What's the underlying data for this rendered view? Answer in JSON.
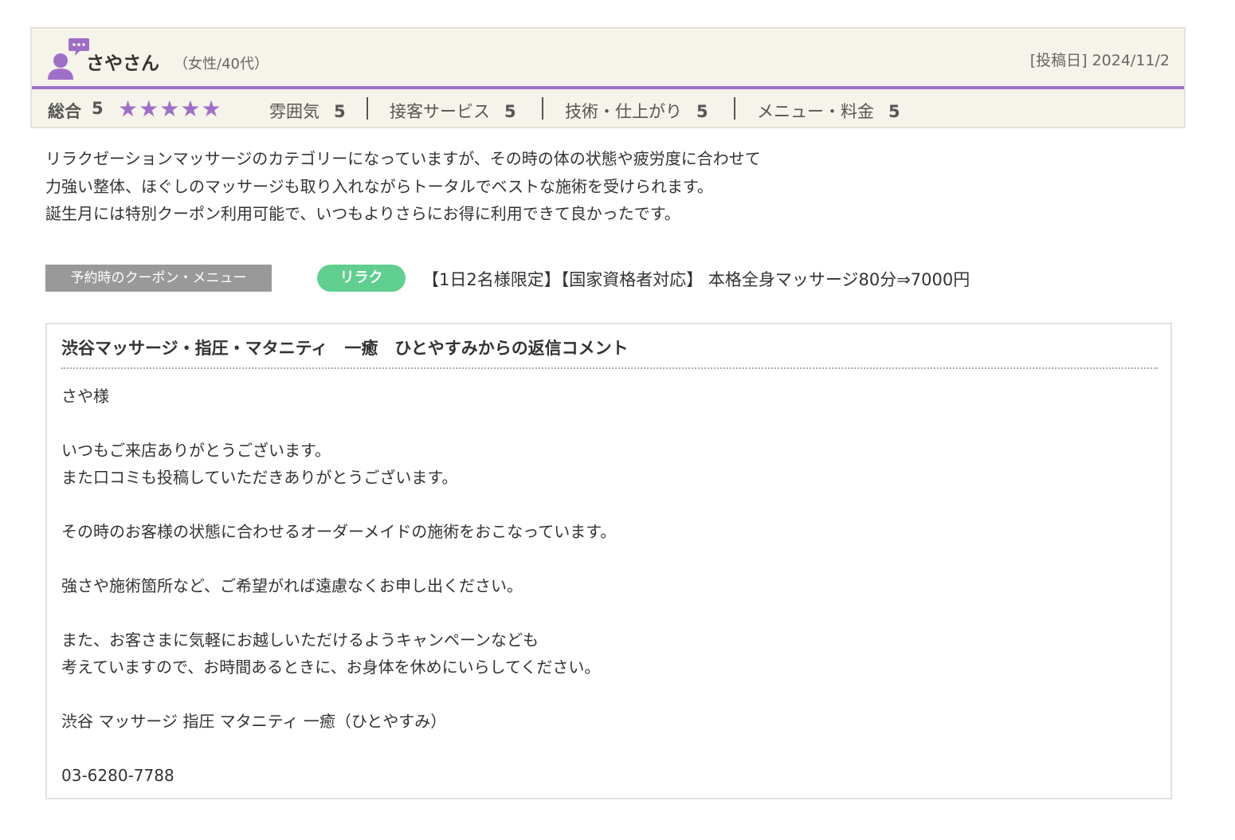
{
  "review": {
    "reviewer_name": "さやさん",
    "reviewer_meta": "（女性/40代）",
    "post_date_label": "[投稿日]",
    "post_date": "2024/11/2",
    "accent_color": "#9f6fc8",
    "avatar_icon": "user-speech-bubble-icon",
    "overall_label": "総合",
    "overall_score": "5",
    "stars": 5,
    "ratings": [
      {
        "label": "雰囲気",
        "value": "5"
      },
      {
        "label": "接客サービス",
        "value": "5"
      },
      {
        "label": "技術・仕上がり",
        "value": "5"
      },
      {
        "label": "メニュー・料金",
        "value": "5"
      }
    ],
    "body_lines": [
      "リラクゼーションマッサージのカテゴリーになっていますが、その時の体の状態や疲労度に合わせて",
      "力強い整体、ほぐしのマッサージも取り入れながらトータルでベストな施術を受けられます。",
      "誕生月には特別クーポン利用可能で、いつもよりさらにお得に利用できて良かったです。"
    ]
  },
  "coupon": {
    "label": "予約時のクーポン・メニュー",
    "tag": "リラク",
    "tag_color": "#5fce8e",
    "menu": "【1日2名様限定】【国家資格者対応】 本格全身マッサージ80分⇒7000円"
  },
  "reply": {
    "title": "渋谷マッサージ・指圧・マタニティ　一癒　ひとやすみからの返信コメント",
    "lines": [
      "さや様",
      "",
      "いつもご来店ありがとうございます。",
      "また口コミも投稿していただきありがとうございます。",
      "",
      "その時のお客様の状態に合わせるオーダーメイドの施術をおこなっています。",
      "",
      "強さや施術箇所など、ご希望がれば遠慮なくお申し出ください。",
      "",
      "また、お客さまに気軽にお越しいただけるようキャンペーンなども",
      "考えていますので、お時間あるときに、お身体を休めにいらしてください。",
      "",
      "渋谷 マッサージ 指圧 マタニティ 一癒（ひとやすみ）",
      "",
      "03-6280-7788"
    ]
  }
}
